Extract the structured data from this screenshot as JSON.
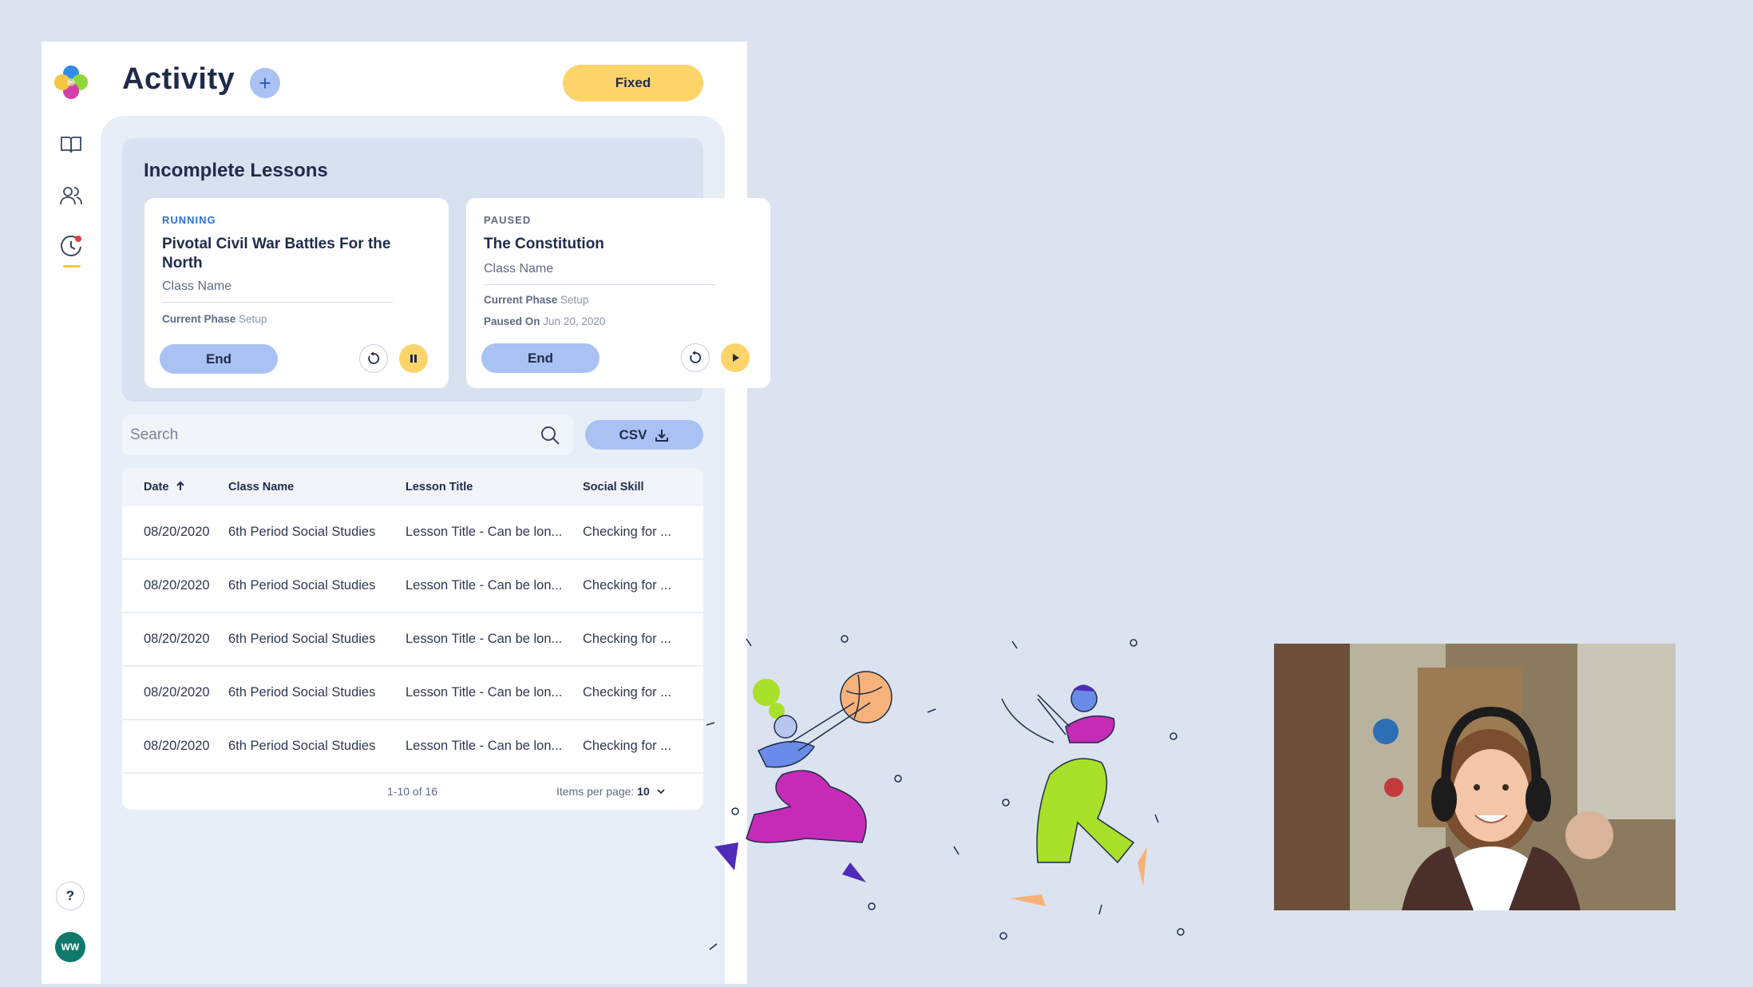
{
  "header": {
    "title": "Activity",
    "add_symbol": "+",
    "fixed_label": "Fixed"
  },
  "sidebar": {
    "items": [
      {
        "icon": "book-icon"
      },
      {
        "icon": "users-icon"
      },
      {
        "icon": "activity-clock-icon",
        "active": true
      }
    ],
    "help_label": "?",
    "avatar_initials": "WW"
  },
  "incomplete": {
    "title": "Incomplete Lessons",
    "cards": [
      {
        "status": "RUNNING",
        "status_color": "#2f6fd6",
        "title": "Pivotal Civil War Battles For the North",
        "class_name": "Class Name",
        "phase_label": "Current Phase",
        "phase_value": "Setup",
        "end_label": "End"
      },
      {
        "status": "PAUSED",
        "status_color": "#5f6b82",
        "title": "The Constitution",
        "class_name": "Class Name",
        "phase_label": "Current Phase",
        "phase_value": "Setup",
        "paused_label": "Paused On",
        "paused_value": "Jun 20, 2020",
        "end_label": "End"
      }
    ]
  },
  "search": {
    "placeholder": "Search",
    "csv_label": "CSV"
  },
  "table": {
    "headers": [
      "Date",
      "Class Name",
      "Lesson Title",
      "Social Skill"
    ],
    "rows": [
      [
        "08/20/2020",
        "6th Period Social Studies",
        "Lesson Title - Can be lon...",
        "Checking for ..."
      ],
      [
        "08/20/2020",
        "6th Period Social Studies",
        "Lesson Title - Can be lon...",
        "Checking for ..."
      ],
      [
        "08/20/2020",
        "6th Period Social Studies",
        "Lesson Title - Can be lon...",
        "Checking for ..."
      ],
      [
        "08/20/2020",
        "6th Period Social Studies",
        "Lesson Title - Can be lon...",
        "Checking for ..."
      ],
      [
        "08/20/2020",
        "6th Period Social Studies",
        "Lesson Title - Can be lon...",
        "Checking for ..."
      ]
    ],
    "range": "1-10 of 16",
    "items_per_page_label": "Items per page:",
    "items_per_page_value": "10"
  },
  "colors": {
    "accent_blue": "#a9c2f3",
    "accent_yellow": "#fcd46a",
    "avatar": "#0e7a6b"
  }
}
